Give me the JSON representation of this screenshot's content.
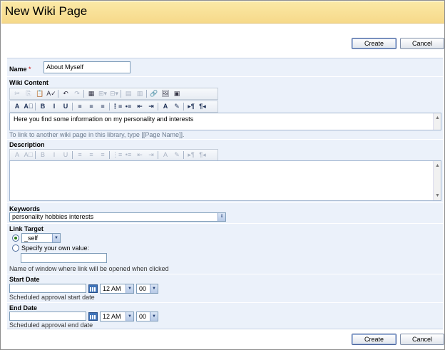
{
  "page": {
    "title": "New Wiki Page"
  },
  "actions": {
    "create_label": "Create",
    "cancel_label": "Cancel"
  },
  "name_field": {
    "label": "Name",
    "required_mark": "*",
    "value": "About Myself"
  },
  "wiki_content": {
    "label": "Wiki Content",
    "toolbar1": [
      "✂",
      "⎘",
      "📋",
      "A✓",
      "↶",
      "↷",
      "▦",
      "⊞▾",
      "⊟▾",
      "▤",
      "▥",
      "🔗",
      "🖼",
      "▣"
    ],
    "toolbar2": [
      "A",
      "A⃞",
      "B",
      "I",
      "U",
      "≡",
      "≡",
      "≡",
      "⋮≡",
      "•≡",
      "⇤",
      "⇥",
      "A",
      "✎",
      "▸¶",
      "¶◂"
    ],
    "text": "Here you find some information on my personality and interests",
    "hint": "To link to another wiki page in this library, type [[Page Name]]."
  },
  "description": {
    "label": "Description",
    "toolbar": [
      "A",
      "A⃞",
      "B",
      "I",
      "U",
      "≡",
      "≡",
      "≡",
      "⋮≡",
      "•≡",
      "⇤",
      "⇥",
      "A",
      "✎",
      "▸¶",
      "¶◂"
    ]
  },
  "keywords": {
    "label": "Keywords",
    "value": "personality hobbies interests"
  },
  "link_target": {
    "label": "Link Target",
    "selected_option": "_self",
    "own_value_label": "Specify your own value:",
    "hint": "Name of window where link will be opened when clicked"
  },
  "start_date": {
    "label": "Start Date",
    "hour": "12 AM",
    "minute": "00",
    "hint": "Scheduled approval start date"
  },
  "end_date": {
    "label": "End Date",
    "hour": "12 AM",
    "minute": "00",
    "hint": "Scheduled approval end date"
  },
  "colors": {
    "title_bar": "#f6d98a",
    "form_bg": "#ebf1fa",
    "required": "#cc0000",
    "hint": "#6b7a8d"
  }
}
